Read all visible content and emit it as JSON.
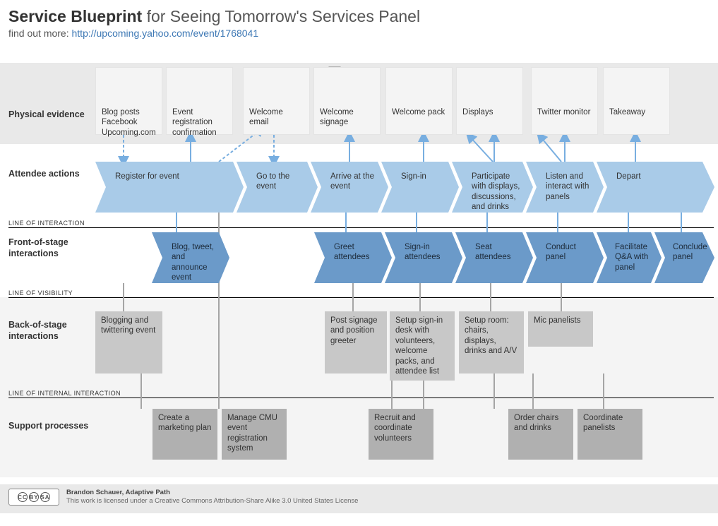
{
  "header": {
    "title_bold": "Service Blueprint",
    "title_rest": " for Seeing Tomorrow's Services Panel",
    "subtext": "find out more: ",
    "url": "http://upcoming.yahoo.com/event/1768041"
  },
  "row_labels": {
    "evidence": "Physical evidence",
    "actions": "Attendee actions",
    "front": "Front-of-stage interactions",
    "back": "Back-of-stage interactions",
    "support": "Support processes"
  },
  "dividers": {
    "interaction": "LINE OF INTERACTION",
    "visibility": "LINE OF VISIBILITY",
    "internal": "LINE OF INTERNAL INTERACTION"
  },
  "evidence": [
    "Blog posts Facebook Upcoming.com",
    "Event registration confirmation",
    "Welcome email",
    "Welcome signage",
    "Welcome pack",
    "Displays",
    "Twitter monitor",
    "Takeaway"
  ],
  "actions": [
    "Register for event",
    "Go to the event",
    "Arrive at the event",
    "Sign-in",
    "Participate with displays, discussions, and drinks",
    "Listen and interact with panels",
    "Depart"
  ],
  "front": [
    "Blog, tweet, and announce event",
    "Greet attendees",
    "Sign-in attendees",
    "Seat attendees",
    "Conduct panel",
    "Facilitate Q&A with panel",
    "Conclude panel"
  ],
  "back": [
    "Blogging and twittering event",
    "Post signage and position greeter",
    "Setup sign-in desk with volunteers, welcome packs, and attendee list",
    "Setup room: chairs, displays, drinks and A/V",
    "Mic panelists"
  ],
  "support": [
    "Create a marketing plan",
    "Manage CMU event registration system",
    "Recruit and coordinate volunteers",
    "Order chairs and drinks",
    "Coordinate panelists"
  ],
  "footer": {
    "author": "Brandon Schauer, Adaptive Path",
    "license": "This work is licensed under a Creative Commons Attribution-Share Alike 3.0 United States License",
    "cc_text": "CC",
    "by": "BY",
    "sa": "SA"
  },
  "colors": {
    "action_fill": "#a9cbe8",
    "front_fill": "#6b9ac9",
    "back_fill": "#c8c8c8",
    "support_fill": "#b0b0b0"
  }
}
